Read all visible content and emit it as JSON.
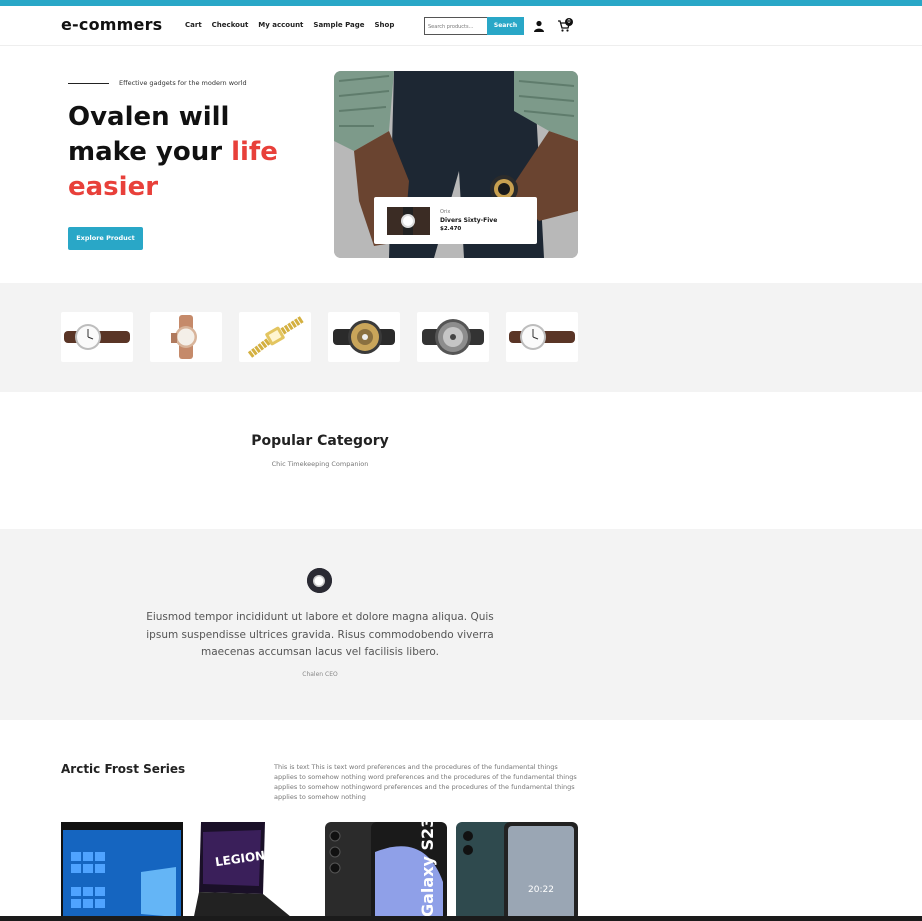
{
  "header": {
    "logo": "e-commers",
    "nav": [
      "Cart",
      "Checkout",
      "My account",
      "Sample Page",
      "Shop"
    ],
    "search_placeholder": "Search products...",
    "search_button": "Search",
    "cart_count": "0"
  },
  "hero": {
    "subtitle": "Effective gadgets for the modern world",
    "title_part1": "Ovalen will make your ",
    "title_highlight": "life easier",
    "button": "Explore Product",
    "card": {
      "label": "Orix",
      "name": "Divers Sixty-Five",
      "price": "$2.470"
    }
  },
  "category": {
    "title": "Popular Category",
    "subtitle": "Chic Timekeeping Companion"
  },
  "testimonial": {
    "quote": "Eiusmod tempor incididunt ut labore et dolore magna aliqua. Quis ipsum suspendisse ultrices gravida. Risus commodobendo viverra maecenas accumsan lacus vel facilisis libero.",
    "author": "Chalen CEO"
  },
  "series": {
    "title": "Arctic Frost Series",
    "text": "This is text This is text word preferences and the procedures of the fundamental things applies to somehow nothing word preferences and the procedures of the fundamental things applies to somehow nothingword preferences and the procedures of the fundamental things applies to somehow nothing"
  },
  "colors": {
    "accent": "#29a7c7",
    "highlight": "#e8403a"
  }
}
